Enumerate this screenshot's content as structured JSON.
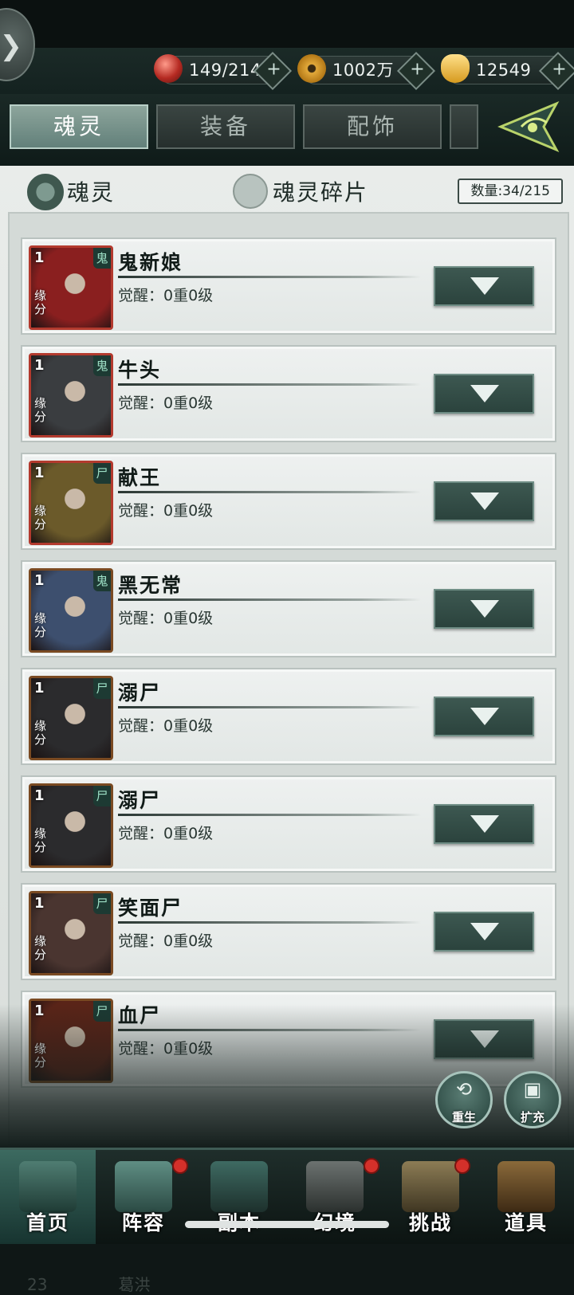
{
  "header": {
    "resources": [
      {
        "icon": "soul-orb-icon",
        "value": "149/214"
      },
      {
        "icon": "coin-icon",
        "value": "1002万"
      },
      {
        "icon": "gold-ingot-icon",
        "value": "12549"
      }
    ],
    "plus": "+"
  },
  "tabs": [
    {
      "label": "魂灵",
      "active": true
    },
    {
      "label": "装备",
      "active": false
    },
    {
      "label": "配饰",
      "active": false
    }
  ],
  "subtabs": {
    "soul_label": "魂灵",
    "fragment_label": "魂灵碎片",
    "count_label": "数量:34/215"
  },
  "cards": [
    {
      "level": "1",
      "fate": "缘分",
      "type": "鬼",
      "name": "鬼新娘",
      "awaken": "觉醒：0重0级",
      "frame": "red"
    },
    {
      "level": "1",
      "fate": "缘分",
      "type": "鬼",
      "name": "牛头",
      "awaken": "觉醒：0重0级",
      "frame": "red"
    },
    {
      "level": "1",
      "fate": "缘分",
      "type": "尸",
      "name": "献王",
      "awaken": "觉醒：0重0级",
      "frame": "red"
    },
    {
      "level": "1",
      "fate": "缘分",
      "type": "鬼",
      "name": "黑无常",
      "awaken": "觉醒：0重0级",
      "frame": "brown"
    },
    {
      "level": "1",
      "fate": "缘分",
      "type": "尸",
      "name": "溺尸",
      "awaken": "觉醒：0重0级",
      "frame": "brown"
    },
    {
      "level": "1",
      "fate": "缘分",
      "type": "尸",
      "name": "溺尸",
      "awaken": "觉醒：0重0级",
      "frame": "brown"
    },
    {
      "level": "1",
      "fate": "缘分",
      "type": "尸",
      "name": "笑面尸",
      "awaken": "觉醒：0重0级",
      "frame": "brown"
    },
    {
      "level": "1",
      "fate": "缘分",
      "type": "尸",
      "name": "血尸",
      "awaken": "觉醒：0重0级",
      "frame": "brown"
    }
  ],
  "partial_row": {
    "level": "23",
    "name": "葛洪"
  },
  "actions": {
    "rebirth_label": "重生",
    "expand_label": "扩充"
  },
  "bottom_nav": [
    {
      "label": "首页",
      "active": true,
      "badge": false
    },
    {
      "label": "阵容",
      "active": false,
      "badge": true
    },
    {
      "label": "副本",
      "active": false,
      "badge": false
    },
    {
      "label": "幻境",
      "active": false,
      "badge": true
    },
    {
      "label": "挑战",
      "active": false,
      "badge": true
    },
    {
      "label": "道具",
      "active": false,
      "badge": false
    }
  ],
  "colors": {
    "accent": "#3d5851",
    "rare_frame": "#b33a2e",
    "common_frame": "#7a4a22",
    "badge": "#d4302a"
  }
}
